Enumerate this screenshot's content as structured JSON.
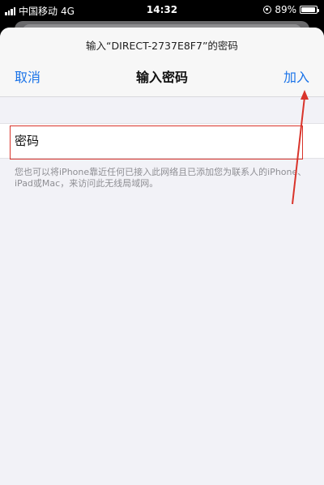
{
  "status_bar": {
    "carrier": "中国移动",
    "network": "4G",
    "time": "14:32",
    "battery": "89%"
  },
  "sheet": {
    "prompt": "输入“DIRECT-2737E8F7”的密码",
    "nav": {
      "cancel_label": "取消",
      "title": "输入密码",
      "join_label": "加入"
    },
    "password_field": {
      "placeholder": "密码",
      "value": ""
    },
    "hint": "您也可以将iPhone靠近任何已接入此网络且已添加您为联系人的iPhone、iPad或Mac，来访问此无线局域网。"
  },
  "colors": {
    "accent": "#1a73e8",
    "annotation": "#d9342b",
    "background": "#f2f2f7"
  },
  "icons": [
    "signal-icon",
    "lock-rotation-icon",
    "battery-icon"
  ]
}
